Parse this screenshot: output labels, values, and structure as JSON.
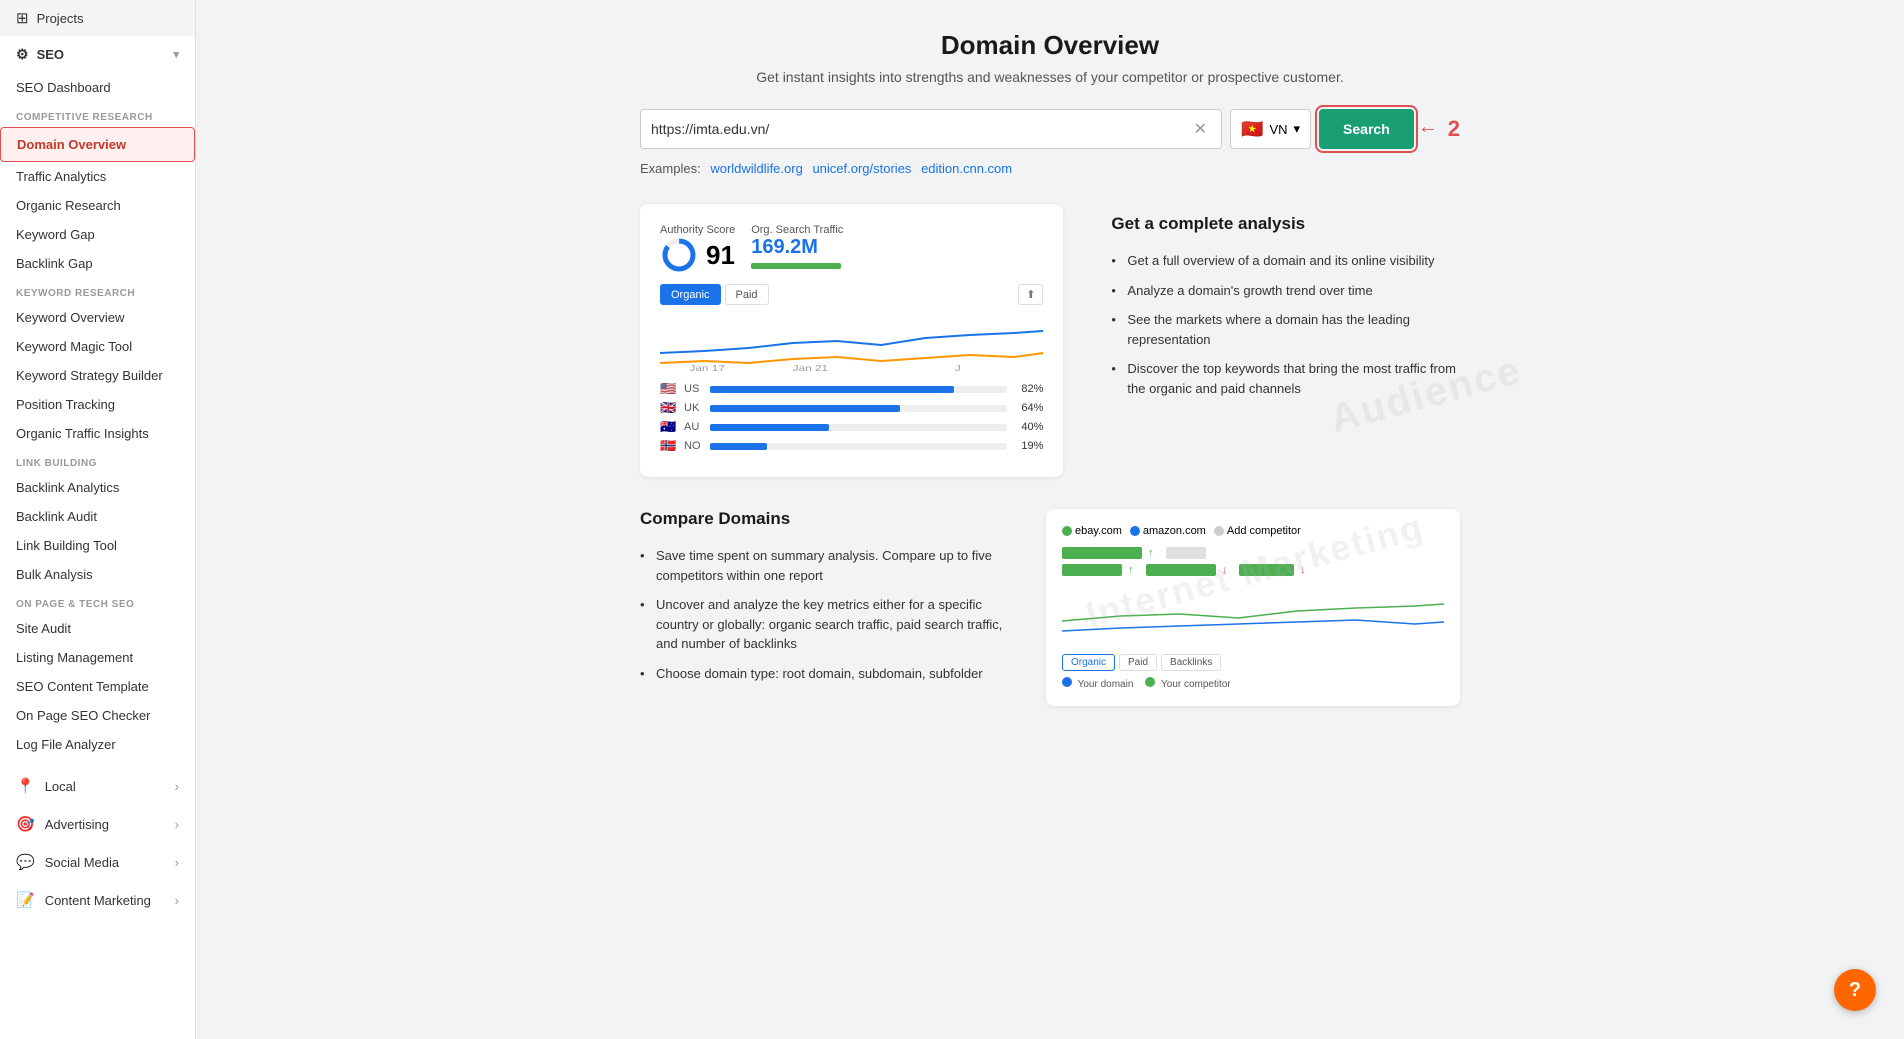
{
  "sidebar": {
    "projects_label": "Projects",
    "seo_label": "SEO",
    "seo_dashboard_label": "SEO Dashboard",
    "competitive_research_label": "COMPETITIVE RESEARCH",
    "domain_overview_label": "Domain Overview",
    "traffic_analytics_label": "Traffic Analytics",
    "organic_research_label": "Organic Research",
    "keyword_gap_label": "Keyword Gap",
    "backlink_gap_label": "Backlink Gap",
    "keyword_research_label": "KEYWORD RESEARCH",
    "keyword_overview_label": "Keyword Overview",
    "keyword_magic_tool_label": "Keyword Magic Tool",
    "keyword_strategy_builder_label": "Keyword Strategy Builder",
    "position_tracking_label": "Position Tracking",
    "organic_traffic_insights_label": "Organic Traffic Insights",
    "link_building_label": "LINK BUILDING",
    "backlink_analytics_label": "Backlink Analytics",
    "backlink_audit_label": "Backlink Audit",
    "link_building_tool_label": "Link Building Tool",
    "bulk_analysis_label": "Bulk Analysis",
    "on_page_tech_seo_label": "ON PAGE & TECH SEO",
    "site_audit_label": "Site Audit",
    "listing_management_label": "Listing Management",
    "seo_content_template_label": "SEO Content Template",
    "on_page_seo_checker_label": "On Page SEO Checker",
    "log_file_analyzer_label": "Log File Analyzer",
    "local_label": "Local",
    "advertising_label": "Advertising",
    "social_media_label": "Social Media",
    "content_marketing_label": "Content Marketing"
  },
  "main": {
    "title": "Domain Overview",
    "subtitle": "Get instant insights into strengths and weaknesses of your competitor or prospective customer.",
    "search_placeholder": "https://imta.edu.vn/",
    "search_value": "https://imta.edu.vn/",
    "country_code": "VN",
    "search_btn_label": "Search",
    "examples_label": "Examples:",
    "example1": "worldwildlife.org",
    "example2": "unicef.org/stories",
    "example3": "edition.cnn.com",
    "authority_score_label": "Authority Score",
    "authority_score_value": "91",
    "org_traffic_label": "Org. Search Traffic",
    "org_traffic_value": "169.2M",
    "tab_organic": "Organic",
    "tab_paid": "Paid",
    "countries": [
      {
        "flag": "🇺🇸",
        "code": "US",
        "pct": 82,
        "label": "82%"
      },
      {
        "flag": "🇬🇧",
        "code": "UK",
        "pct": 64,
        "label": "64%"
      },
      {
        "flag": "🇦🇺",
        "code": "AU",
        "pct": 40,
        "label": "40%"
      },
      {
        "flag": "🇳🇴",
        "code": "NO",
        "pct": 19,
        "label": "19%"
      }
    ],
    "chart_dates": [
      "Jan 17",
      "Jan 21",
      "J"
    ],
    "analysis_title": "Get a complete analysis",
    "analysis_bullets": [
      "Get a full overview of a domain and its online visibility",
      "Analyze a domain's growth trend over time",
      "See the markets where a domain has the leading representation",
      "Discover the top keywords that bring the most traffic from the organic and paid channels"
    ],
    "compare_title": "Compare Domains",
    "compare_bullets": [
      "Save time spent on summary analysis. Compare up to five competitors within one report",
      "Uncover and analyze the key metrics either for a specific country or globally: organic search traffic, paid search traffic, and number of backlinks",
      "Choose domain type: root domain, subdomain, subfolder"
    ],
    "compare_legend": [
      "ebay.com",
      "amazon.com",
      "Add competitor"
    ],
    "compare_tab_organic": "Organic",
    "compare_tab_paid": "Paid",
    "compare_tab_backlinks": "Backlinks",
    "your_domain": "Your domain",
    "your_competitor": "Your competitor",
    "watermark_text": "Internet Marketing",
    "watermark2": "Audience"
  }
}
